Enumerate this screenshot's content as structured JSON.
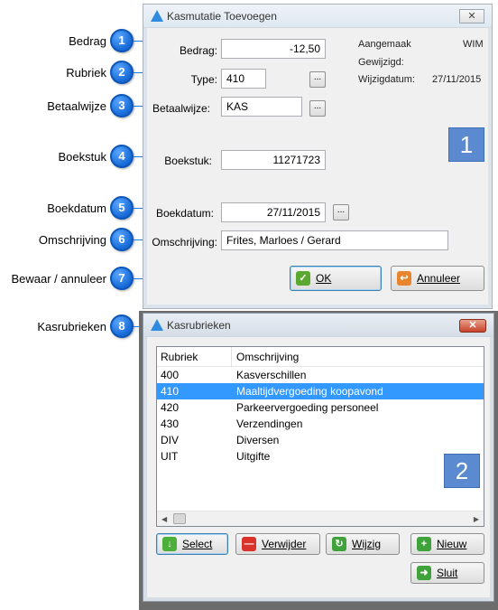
{
  "callouts": [
    {
      "num": "1",
      "label": "Bedrag"
    },
    {
      "num": "2",
      "label": "Rubriek"
    },
    {
      "num": "3",
      "label": "Betaalwijze"
    },
    {
      "num": "4",
      "label": "Boekstuk"
    },
    {
      "num": "5",
      "label": "Boekdatum"
    },
    {
      "num": "6",
      "label": "Omschrijving"
    },
    {
      "num": "7",
      "label": "Bewaar / annuleer"
    },
    {
      "num": "8",
      "label": "Kasrubrieken"
    }
  ],
  "dialog1": {
    "title": "Kasmutatie Toevoegen",
    "close": "✕",
    "bedrag_label": "Bedrag:",
    "bedrag_value": "-12,50",
    "type_label": "Type:",
    "type_value": "410",
    "betaalwijze_label": "Betaalwijze:",
    "betaalwijze_value": "KAS",
    "boekstuk_label": "Boekstuk:",
    "boekstuk_value": "11271723",
    "boekdatum_label": "Boekdatum:",
    "boekdatum_value": "27/11/2015",
    "omschrijving_label": "Omschrijving:",
    "omschrijving_value": "Frites, Marloes / Gerard",
    "lookup_button": "...",
    "aangemaak_label": "Aangemaak",
    "aangemaak_value": "WIM",
    "gewijzigd_label": "Gewijzigd:",
    "gewijzigd_value": "",
    "wijzigdatum_label": "Wijzigdatum:",
    "wijzigdatum_value": "27/11/2015",
    "section_number": "1",
    "ok_label": "OK",
    "annuleer_label": "Annuleer"
  },
  "dialog2": {
    "title": "Kasrubrieken",
    "close": "✕",
    "columns": [
      "Rubriek",
      "Omschrijving"
    ],
    "rows": [
      {
        "code": "400",
        "desc": "Kasverschillen"
      },
      {
        "code": "410",
        "desc": "Maaltijdvergoeding koopavond"
      },
      {
        "code": "420",
        "desc": "Parkeervergoeding personeel"
      },
      {
        "code": "430",
        "desc": "Verzendingen"
      },
      {
        "code": "DIV",
        "desc": "Diversen"
      },
      {
        "code": "UIT",
        "desc": "Uitgifte"
      }
    ],
    "selected_row": 1,
    "section_number": "2",
    "buttons": {
      "select": "Select",
      "verwijder": "Verwijder",
      "wijzig": "Wijzig",
      "nieuw": "Nieuw",
      "sluit": "Sluit"
    }
  },
  "colors": {
    "callout": "#1669d6",
    "selection": "#3399ff",
    "section_box": "#5b8ad0"
  }
}
